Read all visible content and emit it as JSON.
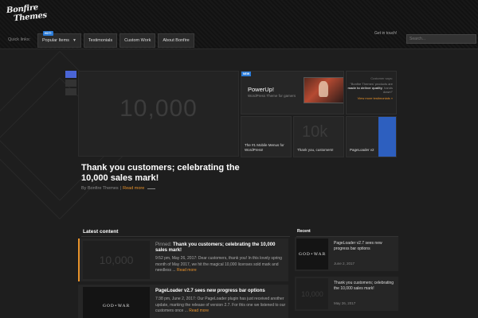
{
  "brand": {
    "logo_line1": "Bonfire",
    "logo_line2": "Themes"
  },
  "header": {
    "quick_links_label": "Quick links:",
    "nav": [
      {
        "label": "Popular Items",
        "badge": "HOT!",
        "dropdown": true
      },
      {
        "label": "Testimonials"
      },
      {
        "label": "Custom Work"
      },
      {
        "label": "About Bonfire"
      }
    ],
    "get_in_touch": "Get in touch!",
    "search_placeholder": "Search..."
  },
  "hero": {
    "image_text": "10,000",
    "title": "Thank you customers; celebrating the 10,000 sales mark!",
    "author": "By Bonfire Themes",
    "separator": "|",
    "read_more": "Read more"
  },
  "featured": {
    "big_tile": {
      "badge": "NEW",
      "title": "PowerUp!",
      "subtitle": "WordPress Theme for gamers"
    },
    "testimonial": {
      "label": "Customer says:",
      "quote_start": "\"Bonfire Themes' products are ",
      "quote_bold": "made to deliver quality",
      "quote_end": ", hands down!\"",
      "link": "View more testimonials »"
    },
    "small_tiles": [
      {
        "caption": "The #1 Mobile Menus for WordPress!",
        "bg": ""
      },
      {
        "caption": "Thank you, customers!",
        "bg": "10k"
      },
      {
        "caption": "PageLoader v2",
        "bg": ""
      }
    ]
  },
  "latest": {
    "heading": "Latest content",
    "posts": [
      {
        "pinned": "Pinned: ",
        "title": "Thank you customers; celebrating the 10,000 sales mark!",
        "thumb_text": "10,000",
        "excerpt": "9:52 pm, May 26, 2017: Dear customers, thank you! In this lovely spring month of May 2017, we hit the magical 10,000 licenses sold mark and needless ...",
        "read_more": "Read more"
      },
      {
        "title": "PageLoader v2.7 sees new progress bar options",
        "thumb_text": "GOD•WAR",
        "excerpt": "7:38 pm, June 2, 2017: Our PageLoader plugin has just received another update, marking the release of version 2.7. For this one we listened to our customers once ...",
        "read_more": "Read more"
      }
    ]
  },
  "recent": {
    "heading": "Recent",
    "items": [
      {
        "title": "PageLoader v2.7 sees new progress bar options",
        "date": "June 2, 2017",
        "thumb_text": "GOD•WAR"
      },
      {
        "title": "Thank you customers; celebrating the 10,000 sales mark!",
        "date": "May 26, 2017",
        "thumb_text": "10,000"
      }
    ]
  },
  "colors": {
    "accent": "#e8922b",
    "badge_blue": "#2a7bd8",
    "background": "#1e1e1e"
  }
}
